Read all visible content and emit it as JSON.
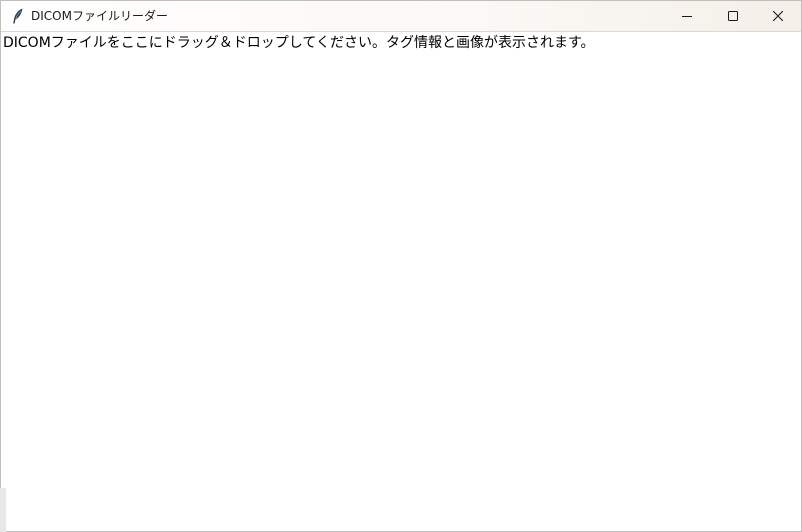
{
  "window": {
    "title": "DICOMファイルリーダー",
    "controls": {
      "minimize_icon": "minimize-icon",
      "maximize_icon": "maximize-icon",
      "close_icon": "close-icon"
    }
  },
  "main": {
    "instruction": "DICOMファイルをここにドラッグ＆ドロップしてください。タグ情報と画像が表示されます。"
  },
  "colors": {
    "titlebar": "#fbf8f5",
    "background": "#ffffff",
    "text": "#000000"
  }
}
